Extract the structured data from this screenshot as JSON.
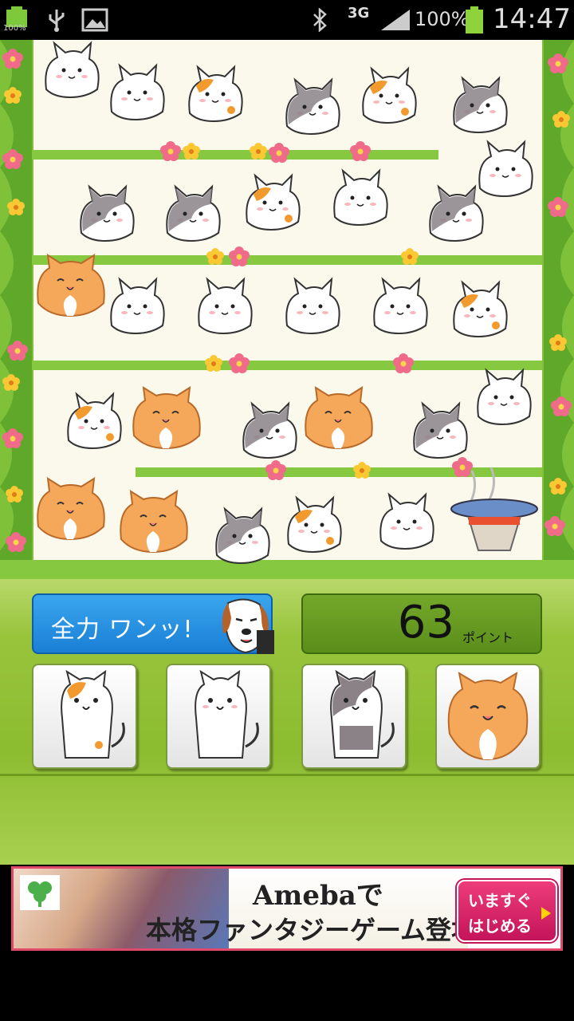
{
  "status_bar": {
    "battery_small_label": "100%",
    "network": "3G",
    "battery_percent": "100%",
    "time": "14:47"
  },
  "game": {
    "full_power_button_label": "全力 ワンッ!",
    "points_value": "63",
    "points_unit": "ポイント",
    "cat_buttons": [
      "calico-cat",
      "white-cat",
      "gray-tabby-cat",
      "orange-fat-cat"
    ],
    "colors": {
      "grass": "#7fc23a",
      "panel_green": "#98c43c",
      "button_blue": "#1a7fd6",
      "points_green": "#5a8e1a"
    }
  },
  "ad": {
    "line1": "Amebaで",
    "line2": "本格ファンタジーゲーム登場！",
    "cta_line1": "いますぐ",
    "cta_line2": "はじめる"
  }
}
